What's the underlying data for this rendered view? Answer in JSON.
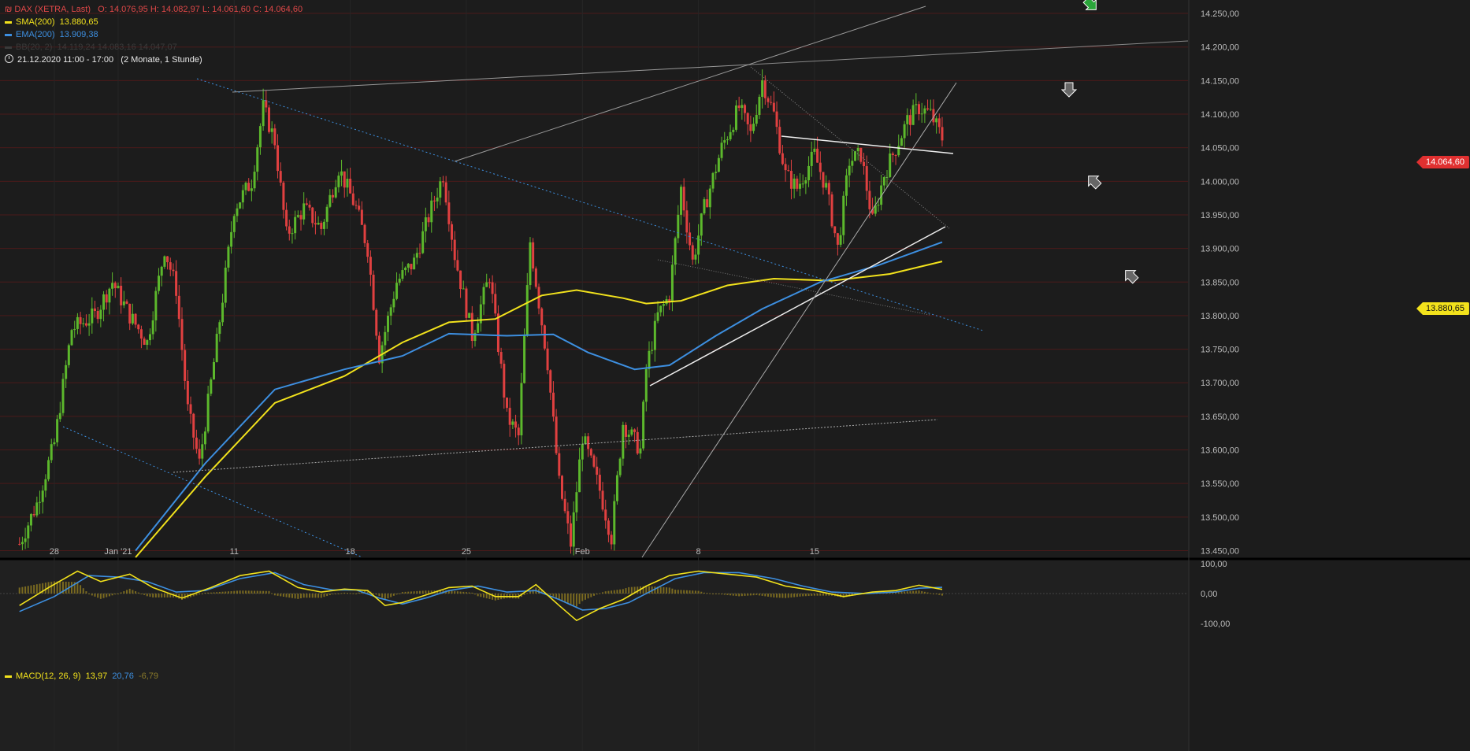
{
  "legend": {
    "main": {
      "icon": "candles-icon",
      "name": "DAX (XETRA, Last)",
      "ohlc": "O: 14.076,95  H: 14.082,97  L: 14.061,60  C: 14.064,60"
    },
    "sma": {
      "name": "SMA(200)",
      "value": "13.880,65"
    },
    "ema": {
      "name": "EMA(200)",
      "value": "13.909,38"
    },
    "bb": {
      "name": "BB(20, 2)",
      "value": "14.119,24  14.083,16  14.047,07"
    },
    "timeframe": {
      "range": "21.12.2020 11:00 - 17:00",
      "span": "(2 Monate, 1 Stunde)"
    },
    "macd": {
      "name": "MACD(12, 26, 9)",
      "macd": "13,97",
      "signal": "20,76",
      "hist": "-6,79"
    }
  },
  "price_tags": {
    "last": {
      "text": "14.064,60",
      "color": "#e03030"
    },
    "sma": {
      "text": "13.880,65",
      "color": "#f2e21c"
    }
  },
  "colors": {
    "up": "#5cb82c",
    "down": "#e04040",
    "sma": "#f2e21c",
    "ema": "#3d8fe0",
    "background": "#1c1c1c",
    "grid": "#4a1a1a"
  },
  "chart_data": {
    "type": "candlestick",
    "title": "DAX (XETRA, Last)",
    "interval": "1 Stunde",
    "x_tick_labels": [
      "28",
      "Jan '21",
      "11",
      "18",
      "25",
      "Feb",
      "8",
      "15"
    ],
    "y_tick_labels": [
      "14.250,00",
      "14.200,00",
      "14.150,00",
      "14.100,00",
      "14.050,00",
      "14.000,00",
      "13.950,00",
      "13.900,00",
      "13.850,00",
      "13.800,00",
      "13.750,00",
      "13.700,00",
      "13.650,00",
      "13.600,00",
      "13.550,00",
      "13.500,00",
      "13.450,00"
    ],
    "ylim": [
      13440,
      14270
    ],
    "close_path": [
      {
        "t": 0,
        "p": 13460
      },
      {
        "t": 3,
        "p": 13520
      },
      {
        "t": 6,
        "p": 13610
      },
      {
        "t": 9,
        "p": 13780
      },
      {
        "t": 13,
        "p": 13800
      },
      {
        "t": 16,
        "p": 13850
      },
      {
        "t": 19,
        "p": 13800
      },
      {
        "t": 22,
        "p": 13760
      },
      {
        "t": 25,
        "p": 13900
      },
      {
        "t": 27,
        "p": 13840
      },
      {
        "t": 29,
        "p": 13660
      },
      {
        "t": 31,
        "p": 13580
      },
      {
        "t": 34,
        "p": 13760
      },
      {
        "t": 37,
        "p": 13960
      },
      {
        "t": 40,
        "p": 14000
      },
      {
        "t": 42,
        "p": 14110
      },
      {
        "t": 44,
        "p": 14060
      },
      {
        "t": 46,
        "p": 13920
      },
      {
        "t": 49,
        "p": 13960
      },
      {
        "t": 52,
        "p": 13930
      },
      {
        "t": 55,
        "p": 14020
      },
      {
        "t": 58,
        "p": 13960
      },
      {
        "t": 60,
        "p": 13900
      },
      {
        "t": 62,
        "p": 13740
      },
      {
        "t": 65,
        "p": 13850
      },
      {
        "t": 68,
        "p": 13880
      },
      {
        "t": 71,
        "p": 13960
      },
      {
        "t": 73,
        "p": 14010
      },
      {
        "t": 75,
        "p": 13890
      },
      {
        "t": 78,
        "p": 13770
      },
      {
        "t": 81,
        "p": 13860
      },
      {
        "t": 84,
        "p": 13650
      },
      {
        "t": 86,
        "p": 13620
      },
      {
        "t": 88,
        "p": 13910
      },
      {
        "t": 91,
        "p": 13730
      },
      {
        "t": 93,
        "p": 13550
      },
      {
        "t": 95,
        "p": 13460
      },
      {
        "t": 97,
        "p": 13620
      },
      {
        "t": 100,
        "p": 13540
      },
      {
        "t": 102,
        "p": 13470
      },
      {
        "t": 104,
        "p": 13640
      },
      {
        "t": 107,
        "p": 13600
      },
      {
        "t": 108,
        "p": 13720
      },
      {
        "t": 110,
        "p": 13800
      },
      {
        "t": 112,
        "p": 13830
      },
      {
        "t": 114,
        "p": 13990
      },
      {
        "t": 116,
        "p": 13880
      },
      {
        "t": 118,
        "p": 13960
      },
      {
        "t": 121,
        "p": 14050
      },
      {
        "t": 124,
        "p": 14110
      },
      {
        "t": 126,
        "p": 14070
      },
      {
        "t": 128,
        "p": 14150
      },
      {
        "t": 130,
        "p": 14100
      },
      {
        "t": 132,
        "p": 14010
      },
      {
        "t": 134,
        "p": 13990
      },
      {
        "t": 137,
        "p": 14040
      },
      {
        "t": 139,
        "p": 13990
      },
      {
        "t": 141,
        "p": 13900
      },
      {
        "t": 143,
        "p": 14030
      },
      {
        "t": 145,
        "p": 14040
      },
      {
        "t": 147,
        "p": 13940
      },
      {
        "t": 149,
        "p": 14010
      },
      {
        "t": 151,
        "p": 14050
      },
      {
        "t": 153,
        "p": 14090
      },
      {
        "t": 155,
        "p": 14110
      },
      {
        "t": 157,
        "p": 14100
      },
      {
        "t": 159,
        "p": 14064.6
      }
    ],
    "sma200": [
      {
        "t": 20,
        "p": 13440
      },
      {
        "t": 32,
        "p": 13560
      },
      {
        "t": 44,
        "p": 13670
      },
      {
        "t": 56,
        "p": 13710
      },
      {
        "t": 66,
        "p": 13760
      },
      {
        "t": 74,
        "p": 13790
      },
      {
        "t": 82,
        "p": 13795
      },
      {
        "t": 90,
        "p": 13830
      },
      {
        "t": 96,
        "p": 13838
      },
      {
        "t": 104,
        "p": 13826
      },
      {
        "t": 108,
        "p": 13818
      },
      {
        "t": 114,
        "p": 13822
      },
      {
        "t": 122,
        "p": 13845
      },
      {
        "t": 130,
        "p": 13855
      },
      {
        "t": 140,
        "p": 13852
      },
      {
        "t": 150,
        "p": 13862
      },
      {
        "t": 159,
        "p": 13880.65
      }
    ],
    "ema200": [
      {
        "t": 20,
        "p": 13450
      },
      {
        "t": 32,
        "p": 13580
      },
      {
        "t": 44,
        "p": 13690
      },
      {
        "t": 56,
        "p": 13720
      },
      {
        "t": 66,
        "p": 13740
      },
      {
        "t": 74,
        "p": 13773
      },
      {
        "t": 84,
        "p": 13770
      },
      {
        "t": 92,
        "p": 13772
      },
      {
        "t": 98,
        "p": 13745
      },
      {
        "t": 106,
        "p": 13720
      },
      {
        "t": 112,
        "p": 13726
      },
      {
        "t": 120,
        "p": 13770
      },
      {
        "t": 128,
        "p": 13810
      },
      {
        "t": 138,
        "p": 13850
      },
      {
        "t": 148,
        "p": 13875
      },
      {
        "t": 159,
        "p": 13909.38
      }
    ],
    "macd_yticks": [
      "100,00",
      "0,00",
      "-100,00"
    ],
    "macd_ylim": [
      -100,
      100
    ],
    "macd": [
      {
        "t": 0,
        "v": -40
      },
      {
        "t": 5,
        "v": 20
      },
      {
        "t": 10,
        "v": 75
      },
      {
        "t": 14,
        "v": 40
      },
      {
        "t": 19,
        "v": 65
      },
      {
        "t": 23,
        "v": 20
      },
      {
        "t": 28,
        "v": -15
      },
      {
        "t": 33,
        "v": 20
      },
      {
        "t": 38,
        "v": 60
      },
      {
        "t": 43,
        "v": 75
      },
      {
        "t": 48,
        "v": 20
      },
      {
        "t": 52,
        "v": 5
      },
      {
        "t": 56,
        "v": 15
      },
      {
        "t": 60,
        "v": 10
      },
      {
        "t": 63,
        "v": -40
      },
      {
        "t": 66,
        "v": -30
      },
      {
        "t": 70,
        "v": -5
      },
      {
        "t": 74,
        "v": 20
      },
      {
        "t": 78,
        "v": 25
      },
      {
        "t": 82,
        "v": -10
      },
      {
        "t": 86,
        "v": -10
      },
      {
        "t": 89,
        "v": 30
      },
      {
        "t": 93,
        "v": -40
      },
      {
        "t": 96,
        "v": -90
      },
      {
        "t": 100,
        "v": -50
      },
      {
        "t": 104,
        "v": -20
      },
      {
        "t": 108,
        "v": 25
      },
      {
        "t": 112,
        "v": 60
      },
      {
        "t": 117,
        "v": 75
      },
      {
        "t": 122,
        "v": 65
      },
      {
        "t": 127,
        "v": 55
      },
      {
        "t": 132,
        "v": 25
      },
      {
        "t": 137,
        "v": 10
      },
      {
        "t": 142,
        "v": -10
      },
      {
        "t": 147,
        "v": 5
      },
      {
        "t": 151,
        "v": 10
      },
      {
        "t": 155,
        "v": 28
      },
      {
        "t": 159,
        "v": 14
      }
    ],
    "macd_signal": [
      {
        "t": 0,
        "v": -60
      },
      {
        "t": 6,
        "v": -10
      },
      {
        "t": 12,
        "v": 60
      },
      {
        "t": 17,
        "v": 55
      },
      {
        "t": 22,
        "v": 40
      },
      {
        "t": 27,
        "v": 5
      },
      {
        "t": 32,
        "v": 10
      },
      {
        "t": 38,
        "v": 50
      },
      {
        "t": 44,
        "v": 70
      },
      {
        "t": 49,
        "v": 30
      },
      {
        "t": 54,
        "v": 12
      },
      {
        "t": 58,
        "v": 12
      },
      {
        "t": 62,
        "v": -15
      },
      {
        "t": 66,
        "v": -35
      },
      {
        "t": 70,
        "v": -15
      },
      {
        "t": 74,
        "v": 10
      },
      {
        "t": 79,
        "v": 25
      },
      {
        "t": 84,
        "v": 5
      },
      {
        "t": 89,
        "v": 10
      },
      {
        "t": 93,
        "v": -20
      },
      {
        "t": 97,
        "v": -55
      },
      {
        "t": 101,
        "v": -50
      },
      {
        "t": 105,
        "v": -30
      },
      {
        "t": 109,
        "v": 10
      },
      {
        "t": 113,
        "v": 50
      },
      {
        "t": 118,
        "v": 70
      },
      {
        "t": 124,
        "v": 70
      },
      {
        "t": 130,
        "v": 50
      },
      {
        "t": 135,
        "v": 25
      },
      {
        "t": 140,
        "v": 5
      },
      {
        "t": 146,
        "v": 0
      },
      {
        "t": 151,
        "v": 5
      },
      {
        "t": 155,
        "v": 18
      },
      {
        "t": 159,
        "v": 20.76
      }
    ]
  }
}
